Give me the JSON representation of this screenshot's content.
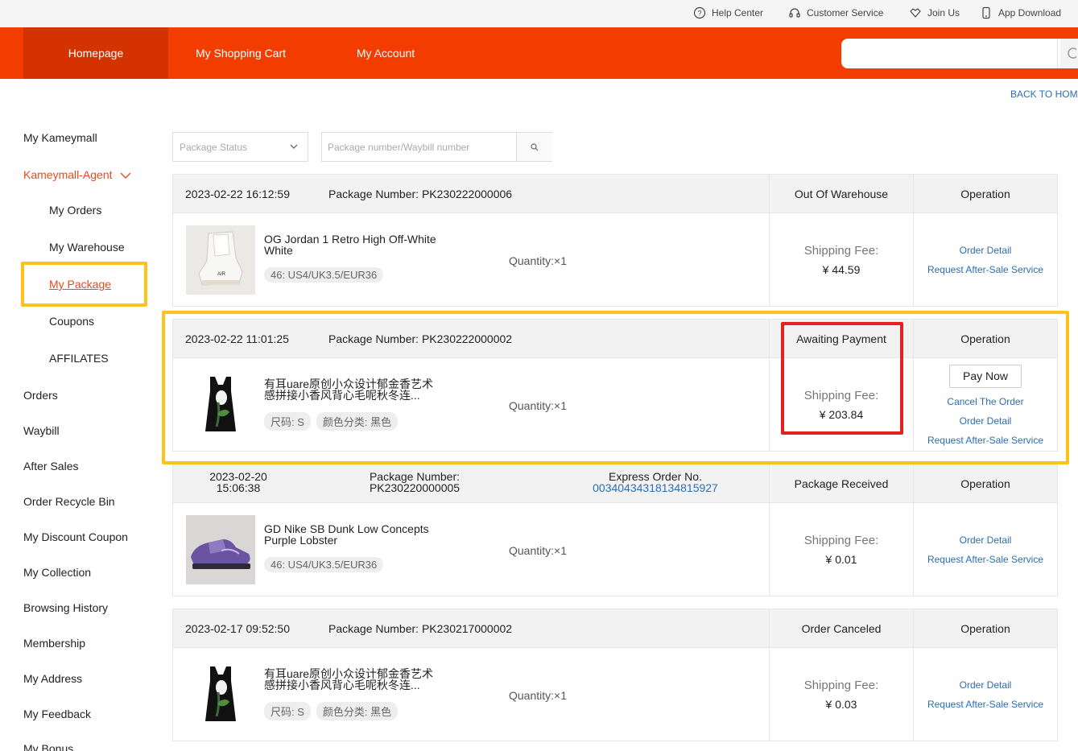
{
  "topbar": {
    "help": "Help Center",
    "service": "Customer Service",
    "join": "Join Us",
    "app": "App Download"
  },
  "nav": {
    "homepage": "Homepage",
    "cart": "My Shopping Cart",
    "account": "My Account",
    "search_placeholder": ""
  },
  "back_home": "BACK TO HOM",
  "sidebar": {
    "my_kameymall": "My Kameymall",
    "agent": "Kameymall-Agent",
    "my_orders": "My Orders",
    "my_warehouse": "My Warehouse",
    "my_package": "My Package",
    "coupons": "Coupons",
    "affiliates": "AFFILATES",
    "orders": "Orders",
    "waybill": "Waybill",
    "after_sales": "After Sales",
    "recycle_bin": "Order Recycle Bin",
    "discount_coupon": "My Discount Coupon",
    "collection": "My Collection",
    "history": "Browsing History",
    "membership": "Membership",
    "address": "My Address",
    "feedback": "My Feedback",
    "bonus": "My Bonus"
  },
  "filters": {
    "status_placeholder": "Package Status",
    "search_placeholder": "Package number/Waybill number"
  },
  "packages": [
    {
      "date": "2023-02-22 16:12:59",
      "package_number": "Package Number: PK230222000006",
      "status": "Out Of Warehouse",
      "operation": "Operation",
      "name": "OG Jordan 1 Retro High Off-White White",
      "tags": [
        "46: US4/UK3.5/EUR36"
      ],
      "quantity": "Quantity:×1",
      "fee_label": "Shipping Fee:",
      "fee": "¥ 44.59",
      "links": [
        "Order Detail",
        "Request After-Sale Service"
      ]
    },
    {
      "date": "2023-02-22 11:01:25",
      "package_number": "Package Number: PK230222000002",
      "status": "Awaiting Payment",
      "operation": "Operation",
      "name": "有耳uare原创小众设计郁金香艺术感拼接小香风背心毛呢秋冬连...",
      "tags": [
        "尺码: S",
        "颜色分类: 黑色"
      ],
      "quantity": "Quantity:×1",
      "fee_label": "Shipping Fee:",
      "fee": "¥ 203.84",
      "pay_now": "Pay Now",
      "links": [
        "Cancel The Order",
        "Order Detail",
        "Request After-Sale Service"
      ]
    },
    {
      "date_line1": "2023-02-20",
      "date_line2": "15:06:38",
      "pn_line1": "Package Number:",
      "pn_line2": "PK230220000005",
      "express_label": "Express Order No.",
      "express_no": "00340434318134815927",
      "status": "Package Received",
      "operation": "Operation",
      "name": "GD Nike SB Dunk Low Concepts Purple Lobster",
      "tags": [
        "46: US4/UK3.5/EUR36"
      ],
      "quantity": "Quantity:×1",
      "fee_label": "Shipping Fee:",
      "fee": "¥ 0.01",
      "links": [
        "Order Detail",
        "Request After-Sale Service"
      ]
    },
    {
      "date": "2023-02-17 09:52:50",
      "package_number": "Package Number: PK230217000002",
      "status": "Order Canceled",
      "operation": "Operation",
      "name": "有耳uare原创小众设计郁金香艺术感拼接小香风背心毛呢秋冬连...",
      "tags": [
        "尺码: S",
        "颜色分类: 黑色"
      ],
      "quantity": "Quantity:×1",
      "fee_label": "Shipping Fee:",
      "fee": "¥ 0.03",
      "links": [
        "Order Detail",
        "Request After-Sale Service"
      ]
    }
  ],
  "colors": {
    "brand_red": "#f23c00",
    "highlight_yellow": "#ffc21a",
    "highlight_red": "#e52020",
    "link_blue": "#2b6db4"
  }
}
